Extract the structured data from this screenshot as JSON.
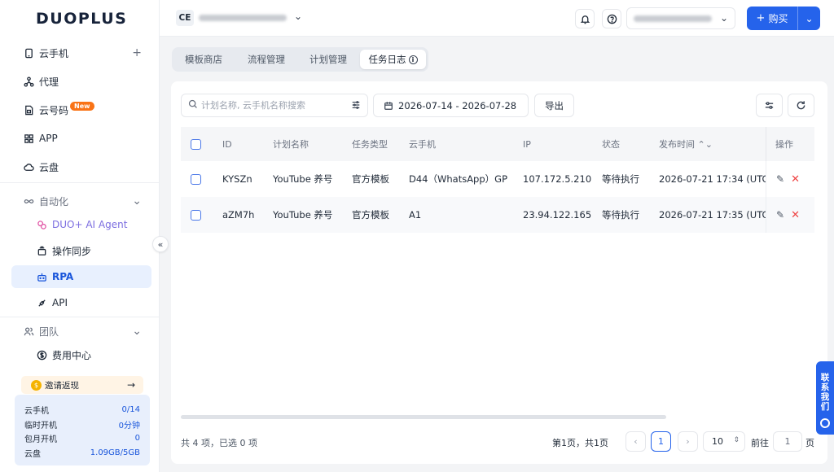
{
  "logo": "DUOPLUS",
  "sidebar": {
    "items": [
      {
        "label": "云手机",
        "icon": "phone-icon",
        "trail": "+"
      },
      {
        "label": "代理",
        "icon": "network-icon"
      },
      {
        "label": "云号码",
        "icon": "sim-card-icon",
        "badge": "New"
      },
      {
        "label": "APP",
        "icon": "grid-icon"
      },
      {
        "label": "云盘",
        "icon": "cloud-icon"
      }
    ],
    "automation": {
      "label": "自动化",
      "children": [
        {
          "label": "DUO+ AI Agent",
          "icon": "ai-agent-icon"
        },
        {
          "label": "操作同步",
          "icon": "sync-icon"
        },
        {
          "label": "RPA",
          "icon": "robot-icon",
          "active": true
        },
        {
          "label": "API",
          "icon": "api-icon"
        }
      ]
    },
    "team": {
      "label": "团队",
      "children": [
        {
          "label": "费用中心",
          "icon": "dollar-icon"
        }
      ]
    },
    "invite": "邀请返现",
    "usage": [
      {
        "label": "云手机",
        "value": "0/14"
      },
      {
        "label": "临时开机",
        "value": "0分钟"
      },
      {
        "label": "包月开机",
        "value": "0"
      },
      {
        "label": "云盘",
        "value": "1.09GB/5GB"
      }
    ]
  },
  "header": {
    "team_badge": "CE",
    "buy_label": "购买"
  },
  "tabs": [
    "模板商店",
    "流程管理",
    "计划管理",
    "任务日志"
  ],
  "active_tab": "任务日志",
  "toolbar": {
    "search_placeholder": "计划名称, 云手机名称搜索",
    "date_range": "2026-07-14 - 2026-07-28",
    "export_label": "导出"
  },
  "table": {
    "columns": [
      "ID",
      "计划名称",
      "任务类型",
      "云手机",
      "IP",
      "状态",
      "发布时间 ⌃⌄",
      "操作"
    ],
    "rows": [
      {
        "id": "KYSZn",
        "plan": "YouTube 养号",
        "type": "官方模板",
        "phone": "D44（WhatsApp）GP",
        "ip": "107.172.5.210",
        "status": "等待执行",
        "time": "2026-07-21 17:34 (UTC+"
      },
      {
        "id": "aZM7h",
        "plan": "YouTube 养号",
        "type": "官方模板",
        "phone": "A1",
        "ip": "23.94.122.165",
        "status": "等待执行",
        "time": "2026-07-21 17:35 (UTC+"
      }
    ]
  },
  "pagination": {
    "total": "共 4 项，已选 0 项",
    "page_info": "第1页，共1页",
    "current": "1",
    "page_size": "10",
    "goto_label": "前往",
    "goto_value": "1",
    "goto_suffix": "页"
  },
  "contact": [
    "联",
    "系",
    "我",
    "们"
  ],
  "colors": {
    "accent": "#2563eb",
    "active_bg": "#e8f0fe",
    "danger": "#ef4444"
  }
}
